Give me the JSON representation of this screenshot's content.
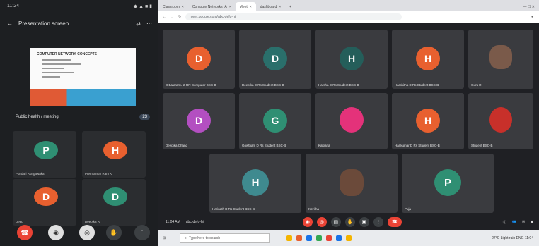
{
  "phone": {
    "status": {
      "time": "11:24",
      "icons": "◆ ▲ ■ ▮"
    },
    "title": "Presentation screen",
    "slide": {
      "title": "COMPUTER NETWORK CONCEPTS"
    },
    "info_text": "Public health / meeting",
    "info_count": "23",
    "participants": [
      {
        "letter": "P",
        "color": "#2f8f73",
        "label": "Pundari Rungawaka"
      },
      {
        "letter": "H",
        "color": "#e8602f",
        "label": "Premkumar Ram K"
      },
      {
        "letter": "D",
        "color": "#e8602f",
        "label": "Deep"
      },
      {
        "letter": "D",
        "color": "#2f8f73",
        "label": "Deepika R"
      }
    ],
    "controls": [
      "end-call",
      "mic",
      "camera",
      "hand",
      "more"
    ]
  },
  "browser": {
    "tabs": [
      "Classroom",
      "ComputerNetworks_A",
      "Meet",
      "dashboard"
    ],
    "url": "meet.google.com/abc-defg-hij",
    "tiles": [
      {
        "kind": "avatar",
        "letter": "D",
        "color": "#e8602f",
        "label": "D Balaramu 2-RN Computer BSC-B"
      },
      {
        "kind": "avatar",
        "letter": "D",
        "color": "#2a6f6b",
        "label": "Deepika D Rs Student BSC-B"
      },
      {
        "kind": "avatar",
        "letter": "H",
        "color": "#245e5a",
        "label": "Harsha D Rs Student BSC-B"
      },
      {
        "kind": "avatar",
        "letter": "H",
        "color": "#e8602f",
        "label": "Harshitha D Rs Student BSC-B"
      },
      {
        "kind": "photo",
        "color": "#7a5a4a",
        "label": "Guru R"
      },
      {
        "kind": "avatar",
        "letter": "D",
        "color": "#b34fc1",
        "label": "Deepika Chand"
      },
      {
        "kind": "avatar",
        "letter": "G",
        "color": "#2f8f73",
        "label": "Gowtham D Rs Student BSC-B"
      },
      {
        "kind": "photo",
        "color": "#e4327a",
        "label": "Kalpana"
      },
      {
        "kind": "avatar",
        "letter": "H",
        "color": "#e8602f",
        "label": "Harikumar D Rs Student BSC-B"
      },
      {
        "kind": "photo",
        "color": "#c8302a",
        "label": "Student BSC-B"
      },
      {
        "kind": "avatar",
        "letter": "H",
        "color": "#3f8a8f",
        "label": "Harinath D Rs Student BSC-B"
      },
      {
        "kind": "photo",
        "color": "#6b4a3a",
        "label": "Kavitha"
      },
      {
        "kind": "avatar",
        "letter": "P",
        "color": "#2f8f73",
        "label": "Puja"
      }
    ],
    "ctrl_time": "11:04 AM",
    "ctrl_code": "abc-defg-hij",
    "taskbar_search": "Type here to search",
    "tray": "27°C Light rain  ENG  11:04"
  }
}
